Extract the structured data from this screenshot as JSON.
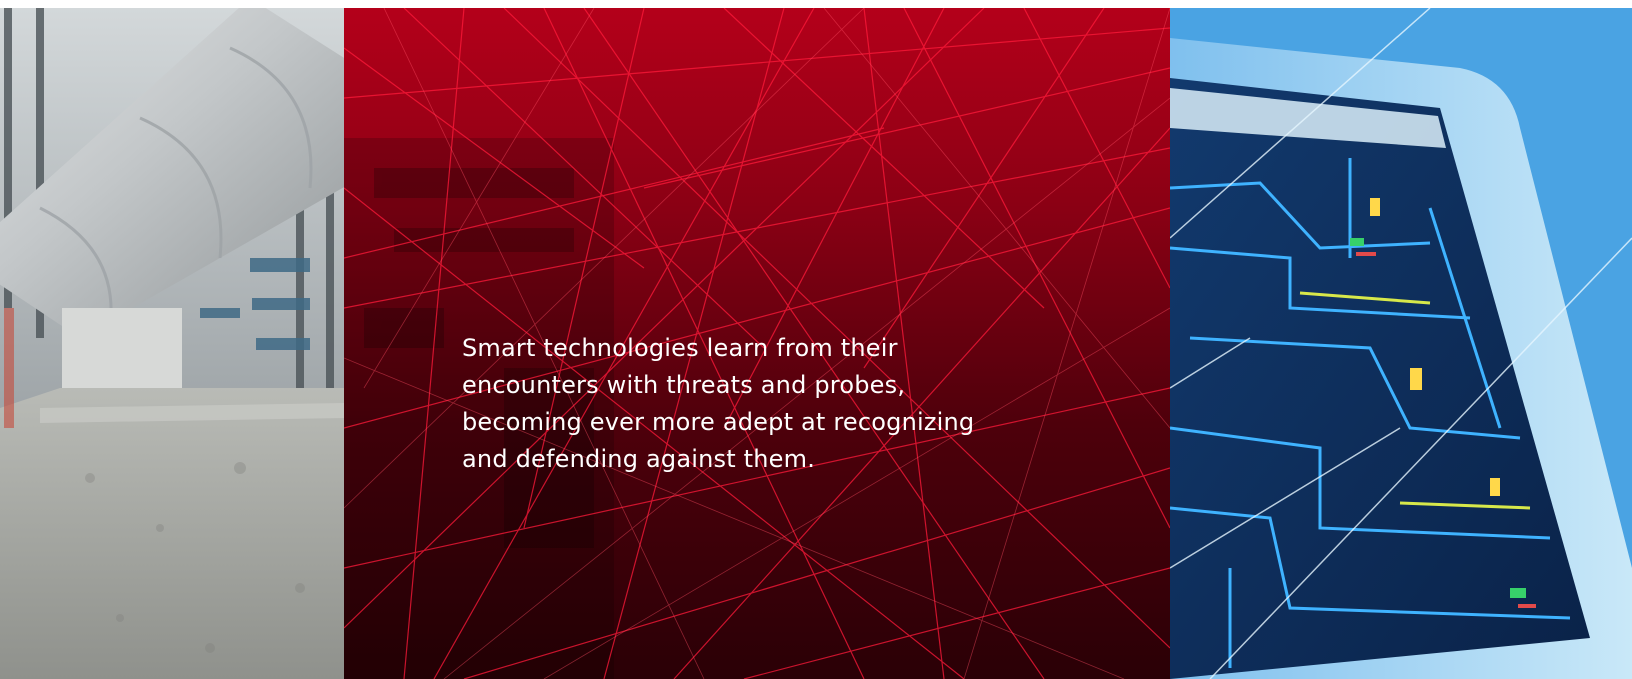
{
  "statement": {
    "text": "Smart technologies learn from their encounters with threats and probes, becoming ever more adept at recognizing and defending against them."
  },
  "colors": {
    "accent_red": "#b4001a",
    "deep_red": "#2a0006",
    "screen_blue": "#3b8fd6",
    "circuit_navy": "#0e2d5a",
    "concrete_gray": "#9a9d9c"
  },
  "images": {
    "left": "industrial-pipe-photo",
    "center": "red-network-lines-graphic",
    "right": "monitor-circuit-diagram-photo"
  }
}
